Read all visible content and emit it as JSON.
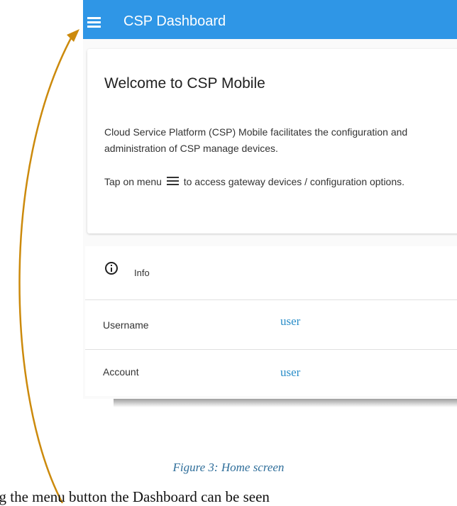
{
  "app": {
    "title": "CSP Dashboard",
    "menu_icon": "menu-icon",
    "header_color": "#2f96e6"
  },
  "welcome": {
    "title": "Welcome to CSP Mobile",
    "paragraph1": "Cloud Service Platform (CSP) Mobile facilitates the configuration and administration of CSP manage devices.",
    "paragraph2_before": "Tap on menu",
    "paragraph2_after": "to access gateway devices / configuration options."
  },
  "info": {
    "icon": "info-icon",
    "label": "Info",
    "rows": [
      {
        "label": "Username",
        "value": "user"
      },
      {
        "label": "Account",
        "value": "user"
      }
    ]
  },
  "caption": "Figure 3: Home screen",
  "body_text": "ng the menu button the Dashboard can be seen",
  "colors": {
    "arrow": "#cc8a0c",
    "value_text": "#2b8ec9",
    "caption": "#2f6e9a"
  }
}
